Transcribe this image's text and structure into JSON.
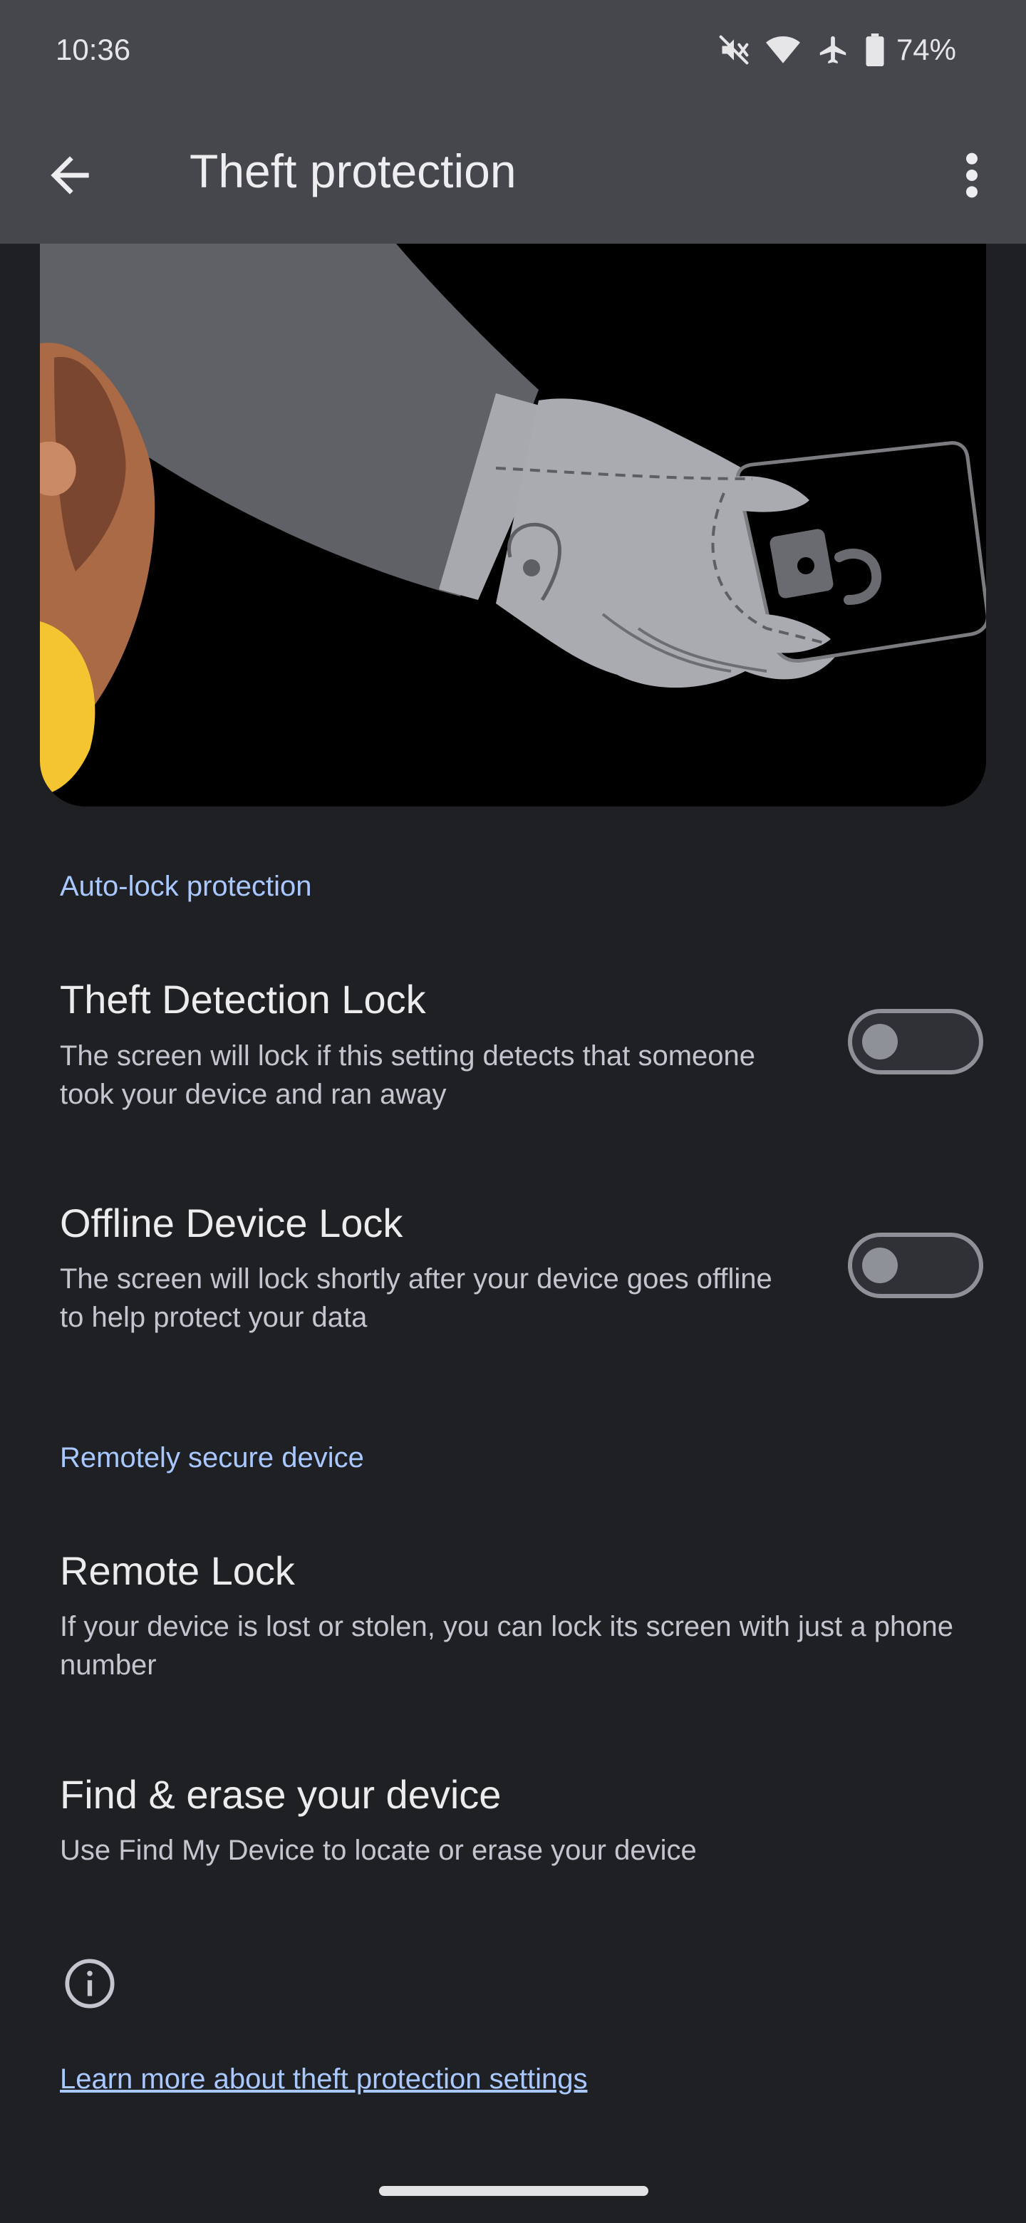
{
  "status_bar": {
    "time": "10:36",
    "battery_percent": "74%",
    "icons": [
      "mute-icon",
      "wifi-icon",
      "airplane-icon",
      "battery-icon"
    ]
  },
  "app_bar": {
    "title": "Theft protection",
    "back_icon": "arrow-back-icon",
    "more_icon": "more-vert-icon"
  },
  "sections": [
    {
      "header": "Auto-lock protection",
      "items": [
        {
          "title": "Theft Detection Lock",
          "summary": "The screen will lock if this setting detects that someone took your device and ran away",
          "toggle_on": false
        },
        {
          "title": "Offline Device Lock",
          "summary": "The screen will lock shortly after your device goes offline to help protect your data",
          "toggle_on": false
        }
      ]
    },
    {
      "header": "Remotely secure device",
      "items": [
        {
          "title": "Remote Lock",
          "summary": "If your device is lost or stolen, you can lock its screen with just a phone number"
        },
        {
          "title": "Find & erase your device",
          "summary": "Use Find My Device to locate or erase your device"
        }
      ]
    }
  ],
  "footer": {
    "info_icon": "info-icon",
    "link": "Learn more about theft protection settings"
  },
  "colors": {
    "background": "#1f2024",
    "app_bar": "#45474d",
    "accent": "#a8c8ff"
  }
}
